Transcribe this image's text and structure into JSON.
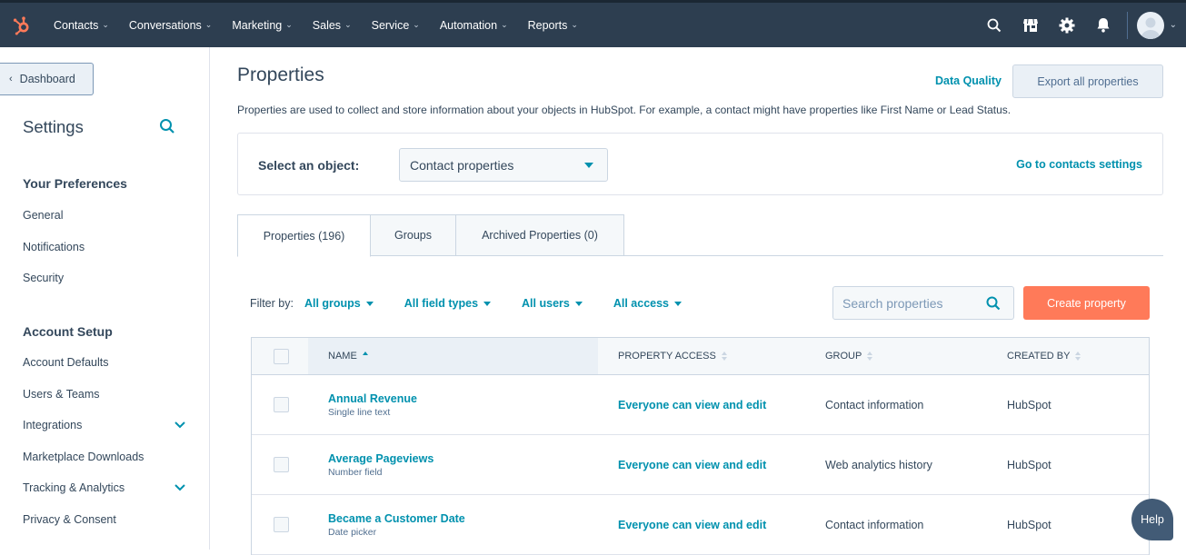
{
  "topnav": {
    "logo": "hubspot-sprocket-icon",
    "brand_color": "#ff7a59",
    "items": [
      {
        "label": "Contacts"
      },
      {
        "label": "Conversations"
      },
      {
        "label": "Marketing"
      },
      {
        "label": "Sales"
      },
      {
        "label": "Service"
      },
      {
        "label": "Automation"
      },
      {
        "label": "Reports"
      }
    ],
    "right_icons": [
      "search-icon",
      "marketplace-icon",
      "gear-icon",
      "bell-icon",
      "avatar"
    ]
  },
  "sidebar": {
    "back_label": "Dashboard",
    "title": "Settings",
    "sections": [
      {
        "heading": "Your Preferences",
        "items": [
          {
            "label": "General"
          },
          {
            "label": "Notifications"
          },
          {
            "label": "Security"
          }
        ]
      },
      {
        "heading": "Account Setup",
        "items": [
          {
            "label": "Account Defaults"
          },
          {
            "label": "Users & Teams"
          },
          {
            "label": "Integrations",
            "expandable": true
          },
          {
            "label": "Marketplace Downloads"
          },
          {
            "label": "Tracking & Analytics",
            "expandable": true
          },
          {
            "label": "Privacy & Consent"
          }
        ]
      }
    ]
  },
  "main": {
    "title": "Properties",
    "data_quality_label": "Data Quality",
    "export_label": "Export all properties",
    "description": "Properties are used to collect and store information about your objects in HubSpot. For example, a contact might have properties like First Name or Lead Status.",
    "object_select": {
      "label": "Select an object:",
      "value": "Contact properties",
      "settings_link": "Go to contacts settings"
    },
    "tabs": [
      {
        "label": "Properties (196)",
        "active": true
      },
      {
        "label": "Groups",
        "active": false
      },
      {
        "label": "Archived Properties (0)",
        "active": false
      }
    ],
    "filters": {
      "label": "Filter by:",
      "groups": "All groups",
      "field_types": "All field types",
      "users": "All users",
      "access": "All access"
    },
    "search_placeholder": "Search properties",
    "create_label": "Create property",
    "table": {
      "columns": [
        "NAME",
        "PROPERTY ACCESS",
        "GROUP",
        "CREATED BY"
      ],
      "sorted_column": "NAME",
      "sort_direction": "ascending",
      "rows": [
        {
          "name": "Annual Revenue",
          "type": "Single line text",
          "access": "Everyone can view and edit",
          "group": "Contact information",
          "created_by": "HubSpot"
        },
        {
          "name": "Average Pageviews",
          "type": "Number field",
          "access": "Everyone can view and edit",
          "group": "Web analytics history",
          "created_by": "HubSpot"
        },
        {
          "name": "Became a Customer Date",
          "type": "Date picker",
          "access": "Everyone can view and edit",
          "group": "Contact information",
          "created_by": "HubSpot"
        }
      ]
    }
  },
  "help_label": "Help",
  "colors": {
    "nav_bg": "#2d3e50",
    "link": "#0091ae",
    "primary_button": "#ff7a59",
    "text": "#33475b",
    "help_bg": "#425b76"
  }
}
